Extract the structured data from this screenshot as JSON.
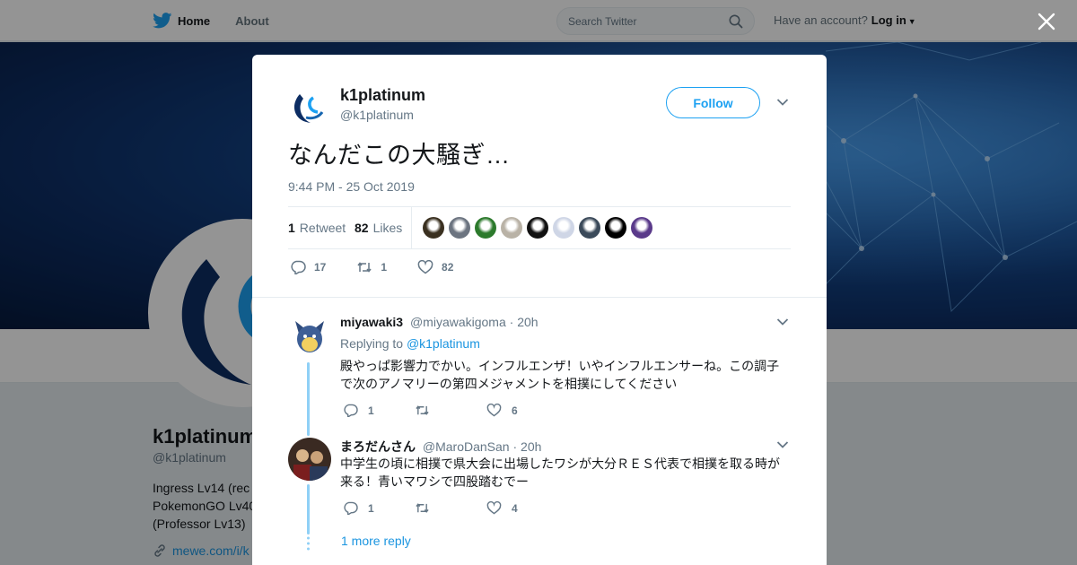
{
  "topbar": {
    "nav": [
      {
        "label": "Home",
        "icon": "twitter-bird-icon"
      },
      {
        "label": "About"
      }
    ],
    "search_placeholder": "Search Twitter",
    "account_prompt": "Have an account?",
    "login_label": "Log in"
  },
  "profile": {
    "name": "k1platinum",
    "handle": "@k1platinum",
    "bio": "Ingress Lv14 (rec\nPokemonGO Lv40\n(Professor Lv13)",
    "link": "mewe.com/i/k"
  },
  "tweet": {
    "author_name": "k1platinum",
    "author_handle": "@k1platinum",
    "follow_label": "Follow",
    "text": "なんだこの大騒ぎ…",
    "timestamp": "9:44 PM - 25 Oct 2019",
    "retweets_count": "1",
    "retweets_label": "Retweet",
    "likes_count": "82",
    "likes_label": "Likes",
    "actions": {
      "replies": "17",
      "retweets": "1",
      "likes": "82"
    },
    "liker_colors": [
      "#3a3020",
      "#6c7480",
      "#2c7a2c",
      "#b9b2a6",
      "#111111",
      "#cfd6e6",
      "#3b4a5a",
      "#000000",
      "#5a3a8a"
    ]
  },
  "replies": [
    {
      "name": "miyawaki3",
      "handle": "@miyawakigoma",
      "time": "20h",
      "replying_prefix": "Replying to",
      "replying_to": "@k1platinum",
      "text": "殿やっぱ影響力でかい。インフルエンザ！いやインフルエンサーね。この調子で次のアノマリーの第四メジャメントを相撲にしてください",
      "reply_count": "1",
      "retweet_count": "",
      "like_count": "6"
    },
    {
      "name": "まろだんさん",
      "handle": "@MaroDanSan",
      "time": "20h",
      "text": "中学生の頃に相撲で県大会に出場したワシが大分ＲＥＳ代表で相撲を取る時が来る！青いマワシで四股踏むでー",
      "reply_count": "1",
      "retweet_count": "",
      "like_count": "4"
    }
  ],
  "more_replies_label": "1 more reply",
  "colors": {
    "accent": "#1da1f2",
    "link": "#1b95e0",
    "muted": "#657786",
    "thread": "#8fd0f6"
  }
}
